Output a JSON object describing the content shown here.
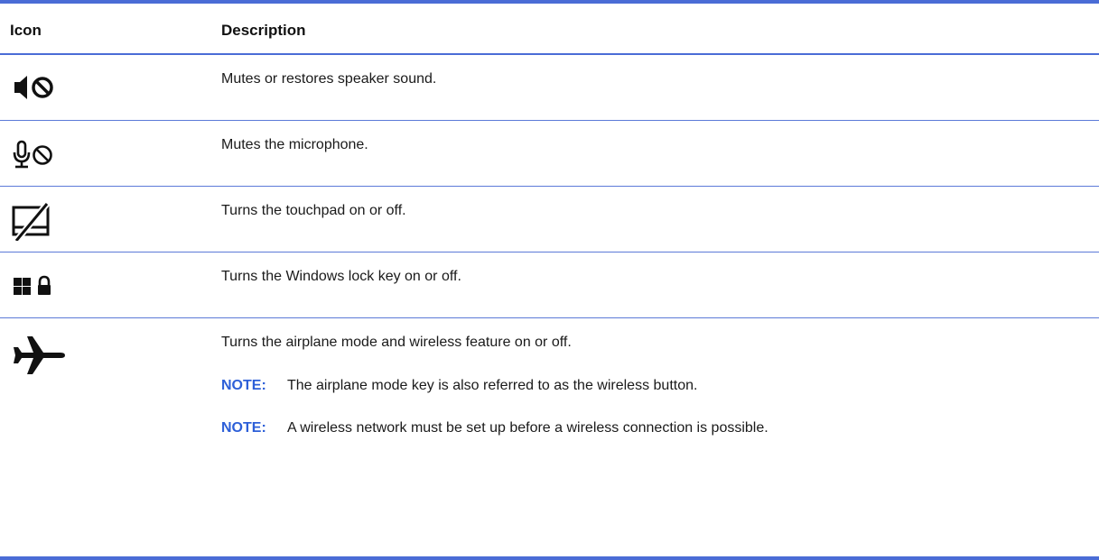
{
  "table": {
    "headers": {
      "icon": "Icon",
      "description": "Description"
    },
    "rows": [
      {
        "icon": "speaker-mute-icon",
        "description": "Mutes or restores speaker sound."
      },
      {
        "icon": "microphone-mute-icon",
        "description": "Mutes the microphone."
      },
      {
        "icon": "touchpad-off-icon",
        "description": "Turns the touchpad on or off."
      },
      {
        "icon": "windows-lock-icon",
        "description": "Turns the Windows lock key on or off."
      },
      {
        "icon": "airplane-icon",
        "description": "Turns the airplane mode and wireless feature on or off.",
        "notes": [
          {
            "label": "NOTE:",
            "text": "The airplane mode key is also referred to as the wireless button."
          },
          {
            "label": "NOTE:",
            "text": "A wireless network must be set up before a wireless connection is possible."
          }
        ]
      }
    ]
  },
  "colors": {
    "rule": "#4a6cd6",
    "note_label": "#2d5fd8",
    "text": "#1a1a1a"
  }
}
